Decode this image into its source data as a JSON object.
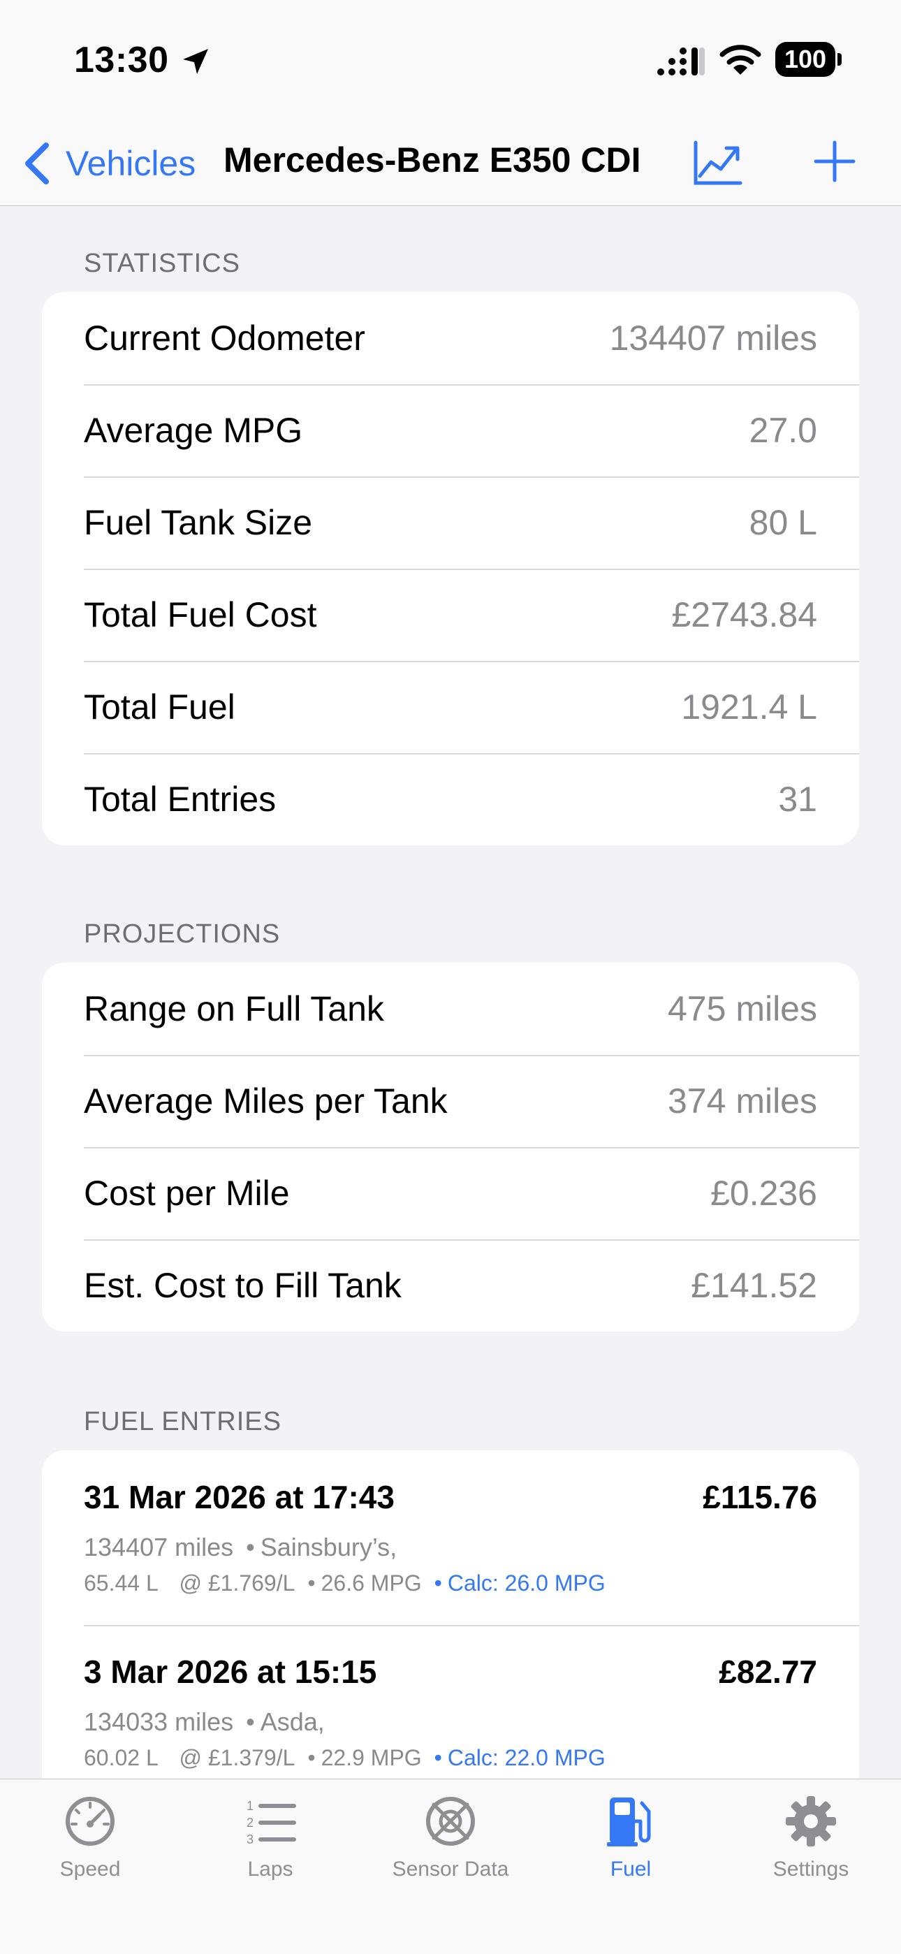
{
  "status_bar": {
    "time": "13:30",
    "battery": "100"
  },
  "nav": {
    "back_label": "Vehicles",
    "title": "Mercedes-Benz E350 CDI"
  },
  "statistics": {
    "header": "STATISTICS",
    "rows": [
      {
        "label": "Current Odometer",
        "value": "134407 miles"
      },
      {
        "label": "Average MPG",
        "value": "27.0"
      },
      {
        "label": "Fuel Tank Size",
        "value": "80 L"
      },
      {
        "label": "Total Fuel Cost",
        "value": "£2743.84"
      },
      {
        "label": "Total Fuel",
        "value": "1921.4 L"
      },
      {
        "label": "Total Entries",
        "value": "31"
      }
    ]
  },
  "projections": {
    "header": "PROJECTIONS",
    "rows": [
      {
        "label": "Range on Full Tank",
        "value": "475 miles"
      },
      {
        "label": "Average Miles per Tank",
        "value": "374 miles"
      },
      {
        "label": "Cost per Mile",
        "value": "£0.236"
      },
      {
        "label": "Est. Cost to Fill Tank",
        "value": "£141.52"
      }
    ]
  },
  "fuel_entries": {
    "header": "FUEL ENTRIES",
    "items": [
      {
        "date": "31 Mar 2026 at 17:43",
        "price": "£115.76",
        "odometer": "134407 miles",
        "station": "Sainsbury’s,",
        "litres": "65.44 L",
        "price_per_litre": "@ £1.769/L",
        "mpg": "26.6 MPG",
        "calc": "Calc: 26.0 MPG"
      },
      {
        "date": "3 Mar 2026 at 15:15",
        "price": "£82.77",
        "odometer": "134033 miles",
        "station": "Asda,",
        "litres": "60.02 L",
        "price_per_litre": "@ £1.379/L",
        "mpg": "22.9 MPG",
        "calc": "Calc: 22.0 MPG"
      }
    ]
  },
  "tab_bar": {
    "tabs": [
      {
        "label": "Speed",
        "icon": "speedometer-icon"
      },
      {
        "label": "Laps",
        "icon": "numbered-list-icon"
      },
      {
        "label": "Sensor Data",
        "icon": "sensor-icon"
      },
      {
        "label": "Fuel",
        "icon": "fuel-pump-icon"
      },
      {
        "label": "Settings",
        "icon": "gear-icon"
      }
    ],
    "active": "Fuel"
  },
  "colors": {
    "accent": "#3478f6",
    "background": "#f2f2f7",
    "secondary_text": "#8a8a8e"
  }
}
